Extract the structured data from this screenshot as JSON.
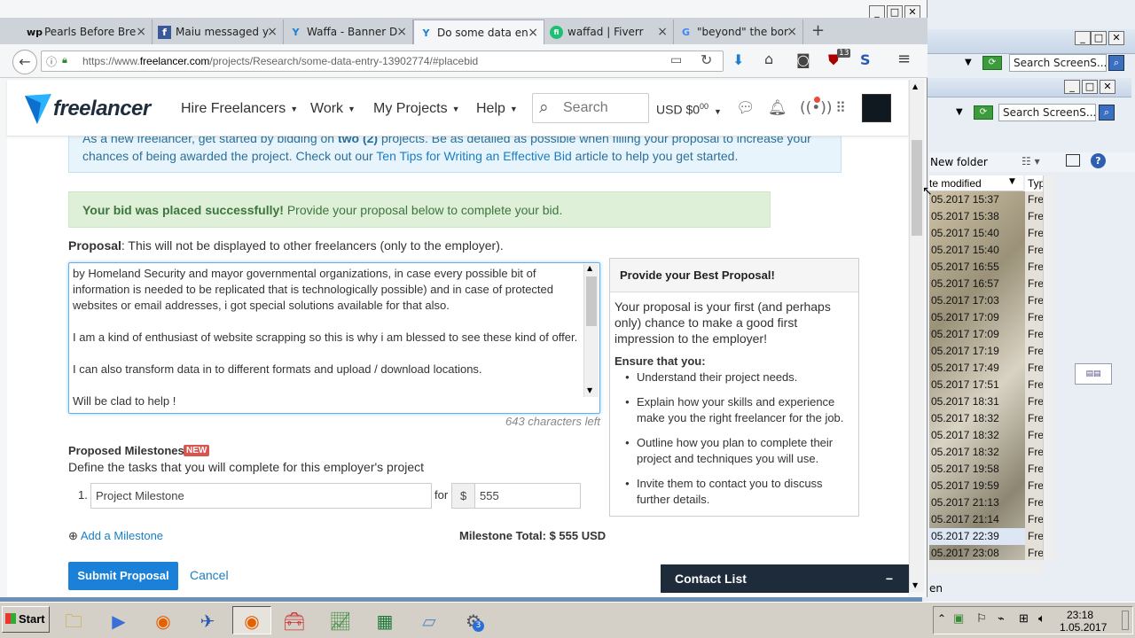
{
  "desktop_bg": {
    "search1": "Search ScreenS...",
    "search2": "Search ScreenS...",
    "new_folder": "New folder",
    "col_modified": "te modified",
    "col_type": "Typ",
    "rows": [
      "05.2017 15:37",
      "05.2017 15:38",
      "05.2017 15:40",
      "05.2017 15:40",
      "05.2017 16:55",
      "05.2017 16:57",
      "05.2017 17:03",
      "05.2017 17:09",
      "05.2017 17:09",
      "05.2017 17:19",
      "05.2017 17:49",
      "05.2017 17:51",
      "05.2017 18:31",
      "05.2017 18:32",
      "05.2017 18:32",
      "05.2017 18:32",
      "05.2017 19:58",
      "05.2017 19:59",
      "05.2017 21:13",
      "05.2017 21:14",
      "05.2017 22:39",
      "05.2017 23:08"
    ],
    "type_label": "Fre",
    "footer_text": "en"
  },
  "browser": {
    "tabs": [
      {
        "label": "Pearls Before Bre",
        "icon": "wp"
      },
      {
        "label": "Maiu messaged y",
        "icon": "f"
      },
      {
        "label": "Waffa - Banner D",
        "icon": "Y"
      },
      {
        "label": "Do some data en",
        "icon": "Y"
      },
      {
        "label": "waffad | Fiverr",
        "icon": "fi"
      },
      {
        "label": "\"beyond\" the bor",
        "icon": "G"
      }
    ],
    "new_tab": "+",
    "url_prefix": "https://www.",
    "url_domain": "freelancer.com",
    "url_path": "/projects/Research/some-data-entry-13902774/#placebid",
    "badge_count": "13"
  },
  "header": {
    "logo_text": "freelancer",
    "nav": [
      "Hire Freelancers",
      "Work",
      "My Projects",
      "Help"
    ],
    "search_placeholder": "Search",
    "balance_prefix": "USD $0",
    "balance_sup": "00"
  },
  "info": {
    "text1": "As a new freelancer, get started by bidding on ",
    "bold": "two (2)",
    "text2": " projects. Be as detailed as possible when filling your proposal to increase your chances of being awarded the project. Check out our ",
    "link": "Ten Tips for Writing an Effective Bid",
    "text3": " article to help you get started."
  },
  "success": {
    "bold": "Your bid was placed successfully!",
    "text": " Provide your proposal below to complete your bid."
  },
  "proposal": {
    "label_bold": "Proposal",
    "label_text": ": This will not be displayed to other freelancers (only to the employer).",
    "text": "by Homeland Security and mayor governmental organizations, in case every possible bit of information is needed to be replicated that is technologically possible) and in case of protected websites or email addresses, i got special solutions available for that also.\n\nI am a kind of enthusiast of website scrapping so this is why i am blessed to see these kind of offer.\n\nI can also transform data in to different formats and upload / download locations.\n\nWill be clad to help !",
    "chars_left": "643 characters left"
  },
  "best": {
    "title": "Provide your Best Proposal!",
    "intro": "Your proposal is your first (and perhaps only) chance to make a good first impression to the employer!",
    "ensure": "Ensure that you:",
    "bullets": [
      "Understand their project needs.",
      "Explain how your skills and experience make you the right freelancer for the job.",
      "Outline how you plan to complete their project and techniques you will use.",
      "Invite them to contact you to discuss further details."
    ]
  },
  "milestones": {
    "title": "Proposed Milestones:",
    "new_badge": "NEW",
    "desc": "Define the tasks that you will complete for this employer's project",
    "num": "1.",
    "name_value": "Project Milestone",
    "for": "for",
    "currency": "$",
    "amount": "555",
    "add": "Add a Milestone",
    "total": "Milestone Total: $ 555 USD"
  },
  "actions": {
    "submit": "Submit Proposal",
    "cancel": "Cancel"
  },
  "contact_list": {
    "title": "Contact List",
    "collapse": "−"
  },
  "taskbar": {
    "start": "Start",
    "time": "23:18",
    "date": "1.05.2017",
    "badge": "3"
  },
  "colors": {
    "brand_blue": "#1a80d8",
    "success_green": "#3c763d",
    "info_text": "#2c7099"
  }
}
